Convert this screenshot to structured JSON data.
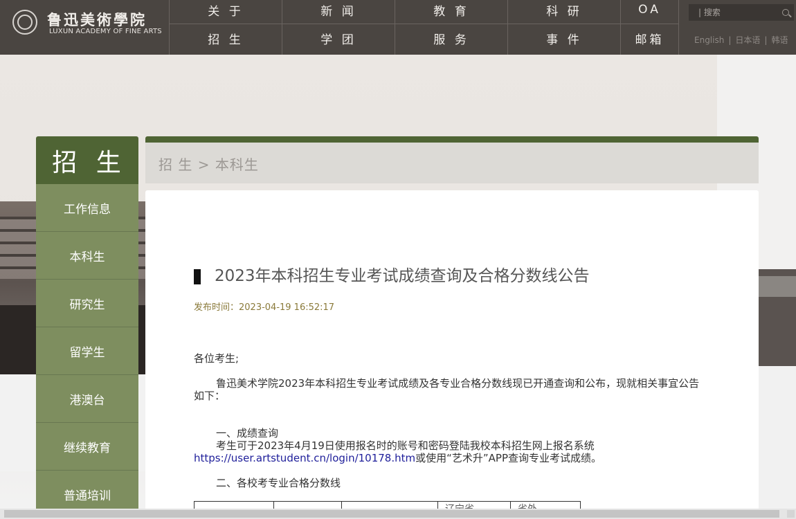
{
  "header": {
    "logo_cn": "鲁迅美術學院",
    "logo_en": "LUXUN ACADEMY OF FINE ARTS",
    "nav_row1": [
      "关 于",
      "新 闻",
      "教 育",
      "科 研",
      "OA"
    ],
    "nav_row2": [
      "招 生",
      "学 团",
      "服 务",
      "事 件",
      "邮箱"
    ],
    "search_placeholder": "| 搜索",
    "languages": [
      "English",
      "日本语",
      "韩语"
    ]
  },
  "sidebar": {
    "title": "招 生",
    "items": [
      "工作信息",
      "本科生",
      "研究生",
      "留学生",
      "港澳台",
      "继续教育",
      "普通培训"
    ]
  },
  "breadcrumb": "招 生 > 本科生",
  "article": {
    "title": "2023年本科招生专业考试成绩查询及合格分数线公告",
    "published": "发布时间：2023-04-19 16:52:17",
    "greeting": "各位考生;",
    "intro": "鲁迅美术学院2023年本科招生专业考试成绩及各专业合格分数线现已开通查询和公布，现就相关事宜公告如下：",
    "section1_heading": "一、成绩查询",
    "section1_text_before": "考生可于2023年4月19日使用报名时的账号和密码登陆我校本科招生网上报名系统",
    "section1_link": "https://user.artstudent.cn/login/10178.htm",
    "section1_text_after": "或使用“艺术升”APP查询专业考试成绩。",
    "section2_heading": "二、各校考专业合格分数线",
    "table_headers": [
      "",
      "",
      "",
      "辽宁省",
      "省外"
    ]
  },
  "colors": {
    "topbar": "#4a4541",
    "accent_green": "#4f6434",
    "menu_green": "#7e8e5f"
  }
}
